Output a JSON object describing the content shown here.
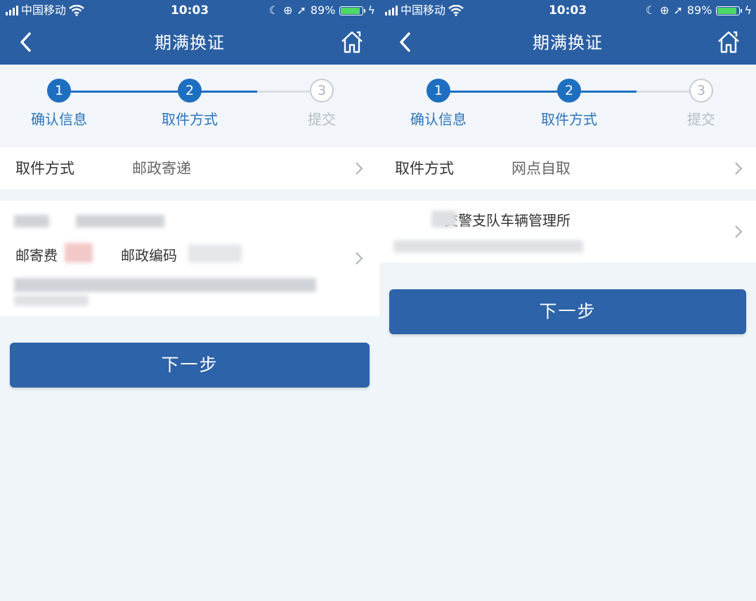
{
  "status_bar": {
    "carrier": "中国移动",
    "time": "10:03",
    "battery": "89%",
    "battery_level": 0.89
  },
  "header": {
    "title": "期满换证"
  },
  "steps": [
    {
      "number": "1",
      "label": "确认信息",
      "state": "done"
    },
    {
      "number": "2",
      "label": "取件方式",
      "state": "current"
    },
    {
      "number": "3",
      "label": "提交",
      "state": "pending"
    }
  ],
  "left_screen": {
    "pickup_label": "取件方式",
    "pickup_value": "邮政寄递",
    "postage_label": "邮寄费",
    "postcode_label": "邮政编码",
    "next_button": "下一步"
  },
  "right_screen": {
    "pickup_label": "取件方式",
    "pickup_value": "网点自取",
    "office_name": "交警支队车辆管理所",
    "next_button": "下一步"
  },
  "colors": {
    "header": "#2a5fa3",
    "step_active": "#1e6fc0",
    "button": "#2d63a8"
  },
  "icons": [
    "back-chevron-icon",
    "home-icon",
    "chevron-right-icon",
    "wifi-icon",
    "signal-icon",
    "battery-icon"
  ]
}
